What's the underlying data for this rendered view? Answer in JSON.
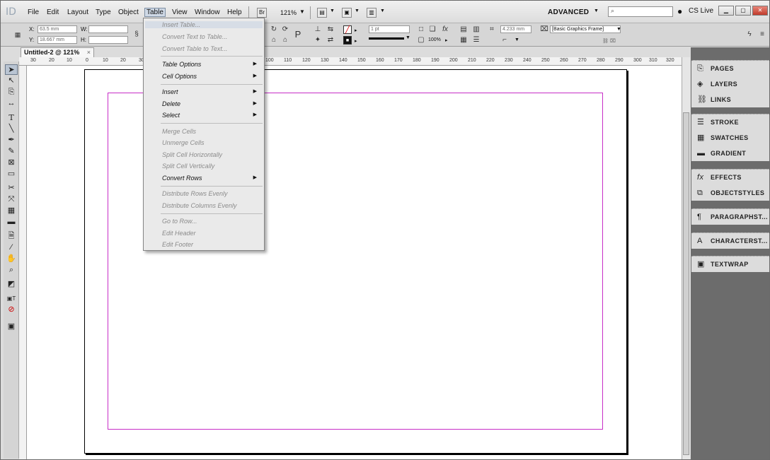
{
  "menubar": {
    "app_logo": "ID",
    "items": [
      "File",
      "Edit",
      "Layout",
      "Type",
      "Object",
      "Table",
      "View",
      "Window",
      "Help"
    ],
    "zoom": "121%",
    "workspace": "ADVANCED",
    "search_placeholder": "",
    "cs_live": "CS Live"
  },
  "controlbar": {
    "x_label": "X:",
    "x_value": "63.5 mm",
    "y_label": "Y:",
    "y_value": "18.667 mm",
    "w_label": "W:",
    "w_value": "",
    "h_label": "H:",
    "h_value": "",
    "stroke_weight": "1 pt",
    "opacity": "100%",
    "offset_value": "4.233 mm",
    "object_style": "[Basic Graphics Frame]"
  },
  "document": {
    "tab_title": "Untitled-2 @ 121%",
    "ruler_labels": [
      "30",
      "20",
      "10",
      "0",
      "10",
      "20",
      "30",
      "40",
      "50",
      "60",
      "70",
      "80",
      "90",
      "100",
      "110",
      "120",
      "130",
      "140",
      "150",
      "160",
      "170",
      "180",
      "190",
      "200",
      "210",
      "220",
      "230",
      "240",
      "250",
      "260",
      "270",
      "280",
      "290",
      "300",
      "310",
      "320"
    ]
  },
  "panels": {
    "group1": [
      "PAGES",
      "LAYERS",
      "LINKS"
    ],
    "group2": [
      "STROKE",
      "SWATCHES",
      "GRADIENT"
    ],
    "group3": [
      "EFFECTS",
      "OBJECTSTYLES"
    ],
    "group4": [
      "PARAGRAPHST..."
    ],
    "group5": [
      "CHARACTERST..."
    ],
    "group6": [
      "TEXTWRAP"
    ]
  },
  "table_menu": {
    "insert_table": "Insert Table...",
    "convert_text_to_table": "Convert Text to Table...",
    "convert_table_to_text": "Convert Table to Text...",
    "table_options": "Table Options",
    "cell_options": "Cell Options",
    "insert": "Insert",
    "delete": "Delete",
    "select": "Select",
    "merge_cells": "Merge Cells",
    "unmerge_cells": "Unmerge Cells",
    "split_cell_horizontally": "Split Cell Horizontally",
    "split_cell_vertically": "Split Cell Vertically",
    "convert_rows": "Convert Rows",
    "distribute_rows_evenly": "Distribute Rows Evenly",
    "distribute_columns_evenly": "Distribute Columns Evenly",
    "go_to_row": "Go to Row...",
    "edit_header": "Edit Header",
    "edit_footer": "Edit Footer"
  },
  "colors": {
    "margin_guide": "#c72dc7",
    "menu_highlight": "#d7dde6",
    "panel_dock": "#6c6c6c"
  }
}
